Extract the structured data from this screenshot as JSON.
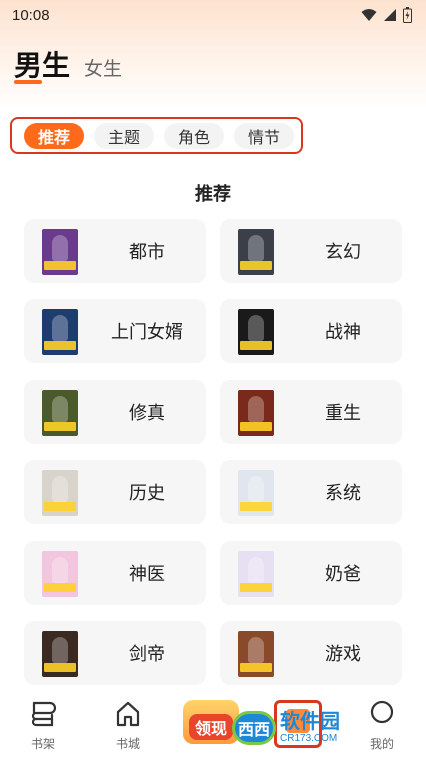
{
  "status": {
    "time": "10:08"
  },
  "gender_tabs": {
    "active": "男生",
    "inactive": "女生"
  },
  "chips": [
    {
      "label": "推荐",
      "active": true
    },
    {
      "label": "主题",
      "active": false
    },
    {
      "label": "角色",
      "active": false
    },
    {
      "label": "情节",
      "active": false
    }
  ],
  "section_title": "推荐",
  "categories": [
    {
      "label": "都市",
      "cover_color": "#6a3a8c"
    },
    {
      "label": "玄幻",
      "cover_color": "#3b3f4a"
    },
    {
      "label": "上门女婿",
      "cover_color": "#1f3c6e"
    },
    {
      "label": "战神",
      "cover_color": "#1a1a1a"
    },
    {
      "label": "修真",
      "cover_color": "#4a5a2a"
    },
    {
      "label": "重生",
      "cover_color": "#7a2a1a"
    },
    {
      "label": "历史",
      "cover_color": "#d8d4cc"
    },
    {
      "label": "系统",
      "cover_color": "#dfe6ee"
    },
    {
      "label": "神医",
      "cover_color": "#f2c6de"
    },
    {
      "label": "奶爸",
      "cover_color": "#e7e0f2"
    },
    {
      "label": "剑帝",
      "cover_color": "#3a2a22"
    },
    {
      "label": "游戏",
      "cover_color": "#8a4a2a"
    }
  ],
  "bottom_nav": {
    "shelf": "书架",
    "store": "书城",
    "promo": "领现",
    "mine": "我的"
  },
  "watermark": {
    "logo": "西西",
    "main": "软件园",
    "sub": "CR173.COM"
  },
  "colors": {
    "accent": "#ff6a1a",
    "highlight": "#d9381e"
  }
}
